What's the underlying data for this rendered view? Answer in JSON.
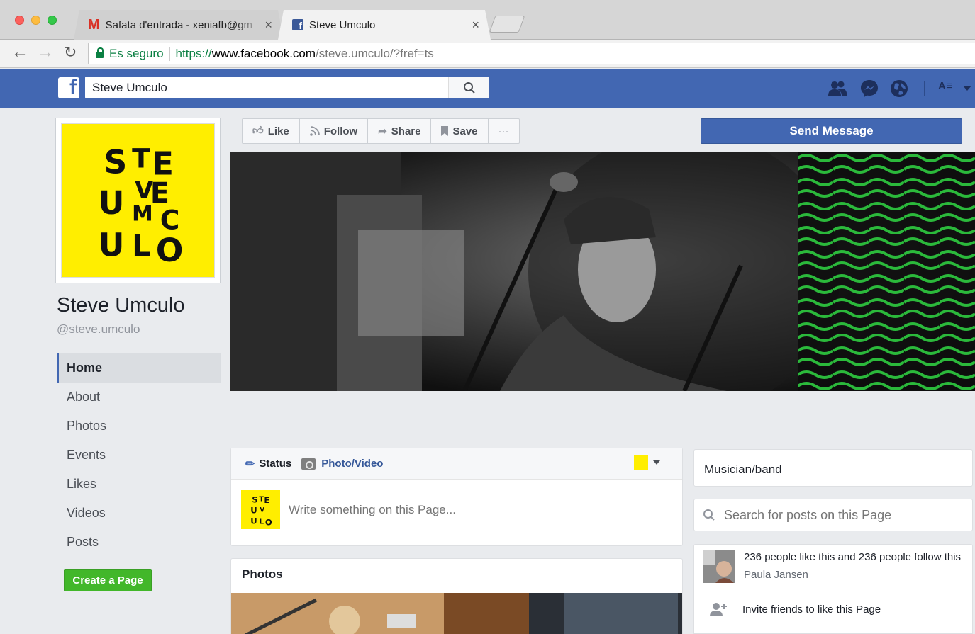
{
  "browser": {
    "tabs": [
      {
        "title": "Safata d'entrada - xeniafb@gm",
        "icon": "gmail-icon",
        "active": false
      },
      {
        "title": "Steve Umculo",
        "icon": "facebook-icon",
        "active": true
      }
    ],
    "address": {
      "secure_label": "Es seguro",
      "scheme": "https://",
      "host": "www.facebook.com",
      "path": "/steve.umculo/?fref=ts"
    }
  },
  "fb_header": {
    "search_value": "Steve Umculo",
    "privacy_label": "A≡"
  },
  "page": {
    "name": "Steve Umculo",
    "username": "@steve.umculo",
    "profile_letters": [
      "S",
      "T",
      "E",
      "V",
      "E",
      "U",
      "M",
      "C",
      "U",
      "L",
      "O"
    ]
  },
  "nav": {
    "items": [
      "Home",
      "About",
      "Photos",
      "Events",
      "Likes",
      "Videos",
      "Posts"
    ],
    "active": "Home",
    "create_page_label": "Create a Page"
  },
  "actions": {
    "like": "Like",
    "follow": "Follow",
    "share": "Share",
    "save": "Save",
    "more": "···",
    "send_message": "Send Message"
  },
  "composer": {
    "status_tab": "Status",
    "photo_tab": "Photo/Video",
    "placeholder": "Write something on this Page..."
  },
  "photos": {
    "title": "Photos"
  },
  "about": {
    "category": "Musician/band",
    "search_placeholder": "Search for posts on this Page",
    "likes_text": "236 people like this and 236 people follow this",
    "liked_by": "Paula Jansen",
    "invite_text": "Invite friends to like this Page"
  },
  "colors": {
    "facebook_blue": "#4267b2",
    "brand_yellow": "#ffee00",
    "cover_green": "#2ecc40",
    "create_green": "#42b72a"
  }
}
